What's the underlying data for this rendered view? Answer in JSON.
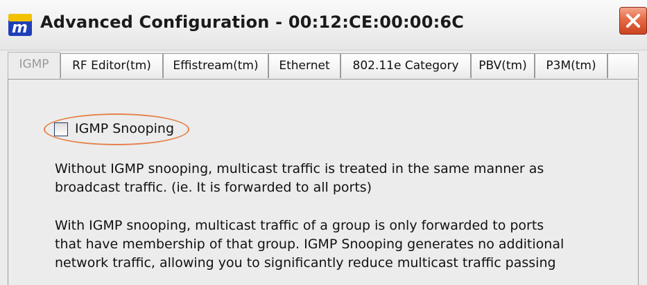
{
  "window": {
    "title": "Advanced Configuration - 00:12:CE:00:00:6C",
    "app_icon": "app-logo-icon",
    "close_icon": "close-icon"
  },
  "tabs": [
    {
      "label": "IGMP",
      "active": true
    },
    {
      "label": "RF Editor(tm)",
      "active": false
    },
    {
      "label": "Effistream(tm)",
      "active": false
    },
    {
      "label": "Ethernet",
      "active": false
    },
    {
      "label": "802.11e Category",
      "active": false
    },
    {
      "label": "PBV(tm)",
      "active": false
    },
    {
      "label": "P3M(tm)",
      "active": false
    }
  ],
  "igmp": {
    "snooping_label": "IGMP Snooping",
    "snooping_checked": false,
    "paragraph1": "Without IGMP snooping, multicast traffic is treated in the same manner as\nbroadcast traffic. (ie. It is forwarded to all ports)",
    "paragraph2": "With IGMP snooping, multicast traffic of a group is only forwarded to ports\nthat have membership of that group. IGMP Snooping generates no additional\nnetwork traffic, allowing you to significantly reduce multicast traffic passing"
  },
  "colors": {
    "highlight": "#e5824a",
    "close_button": "#e56a45"
  }
}
